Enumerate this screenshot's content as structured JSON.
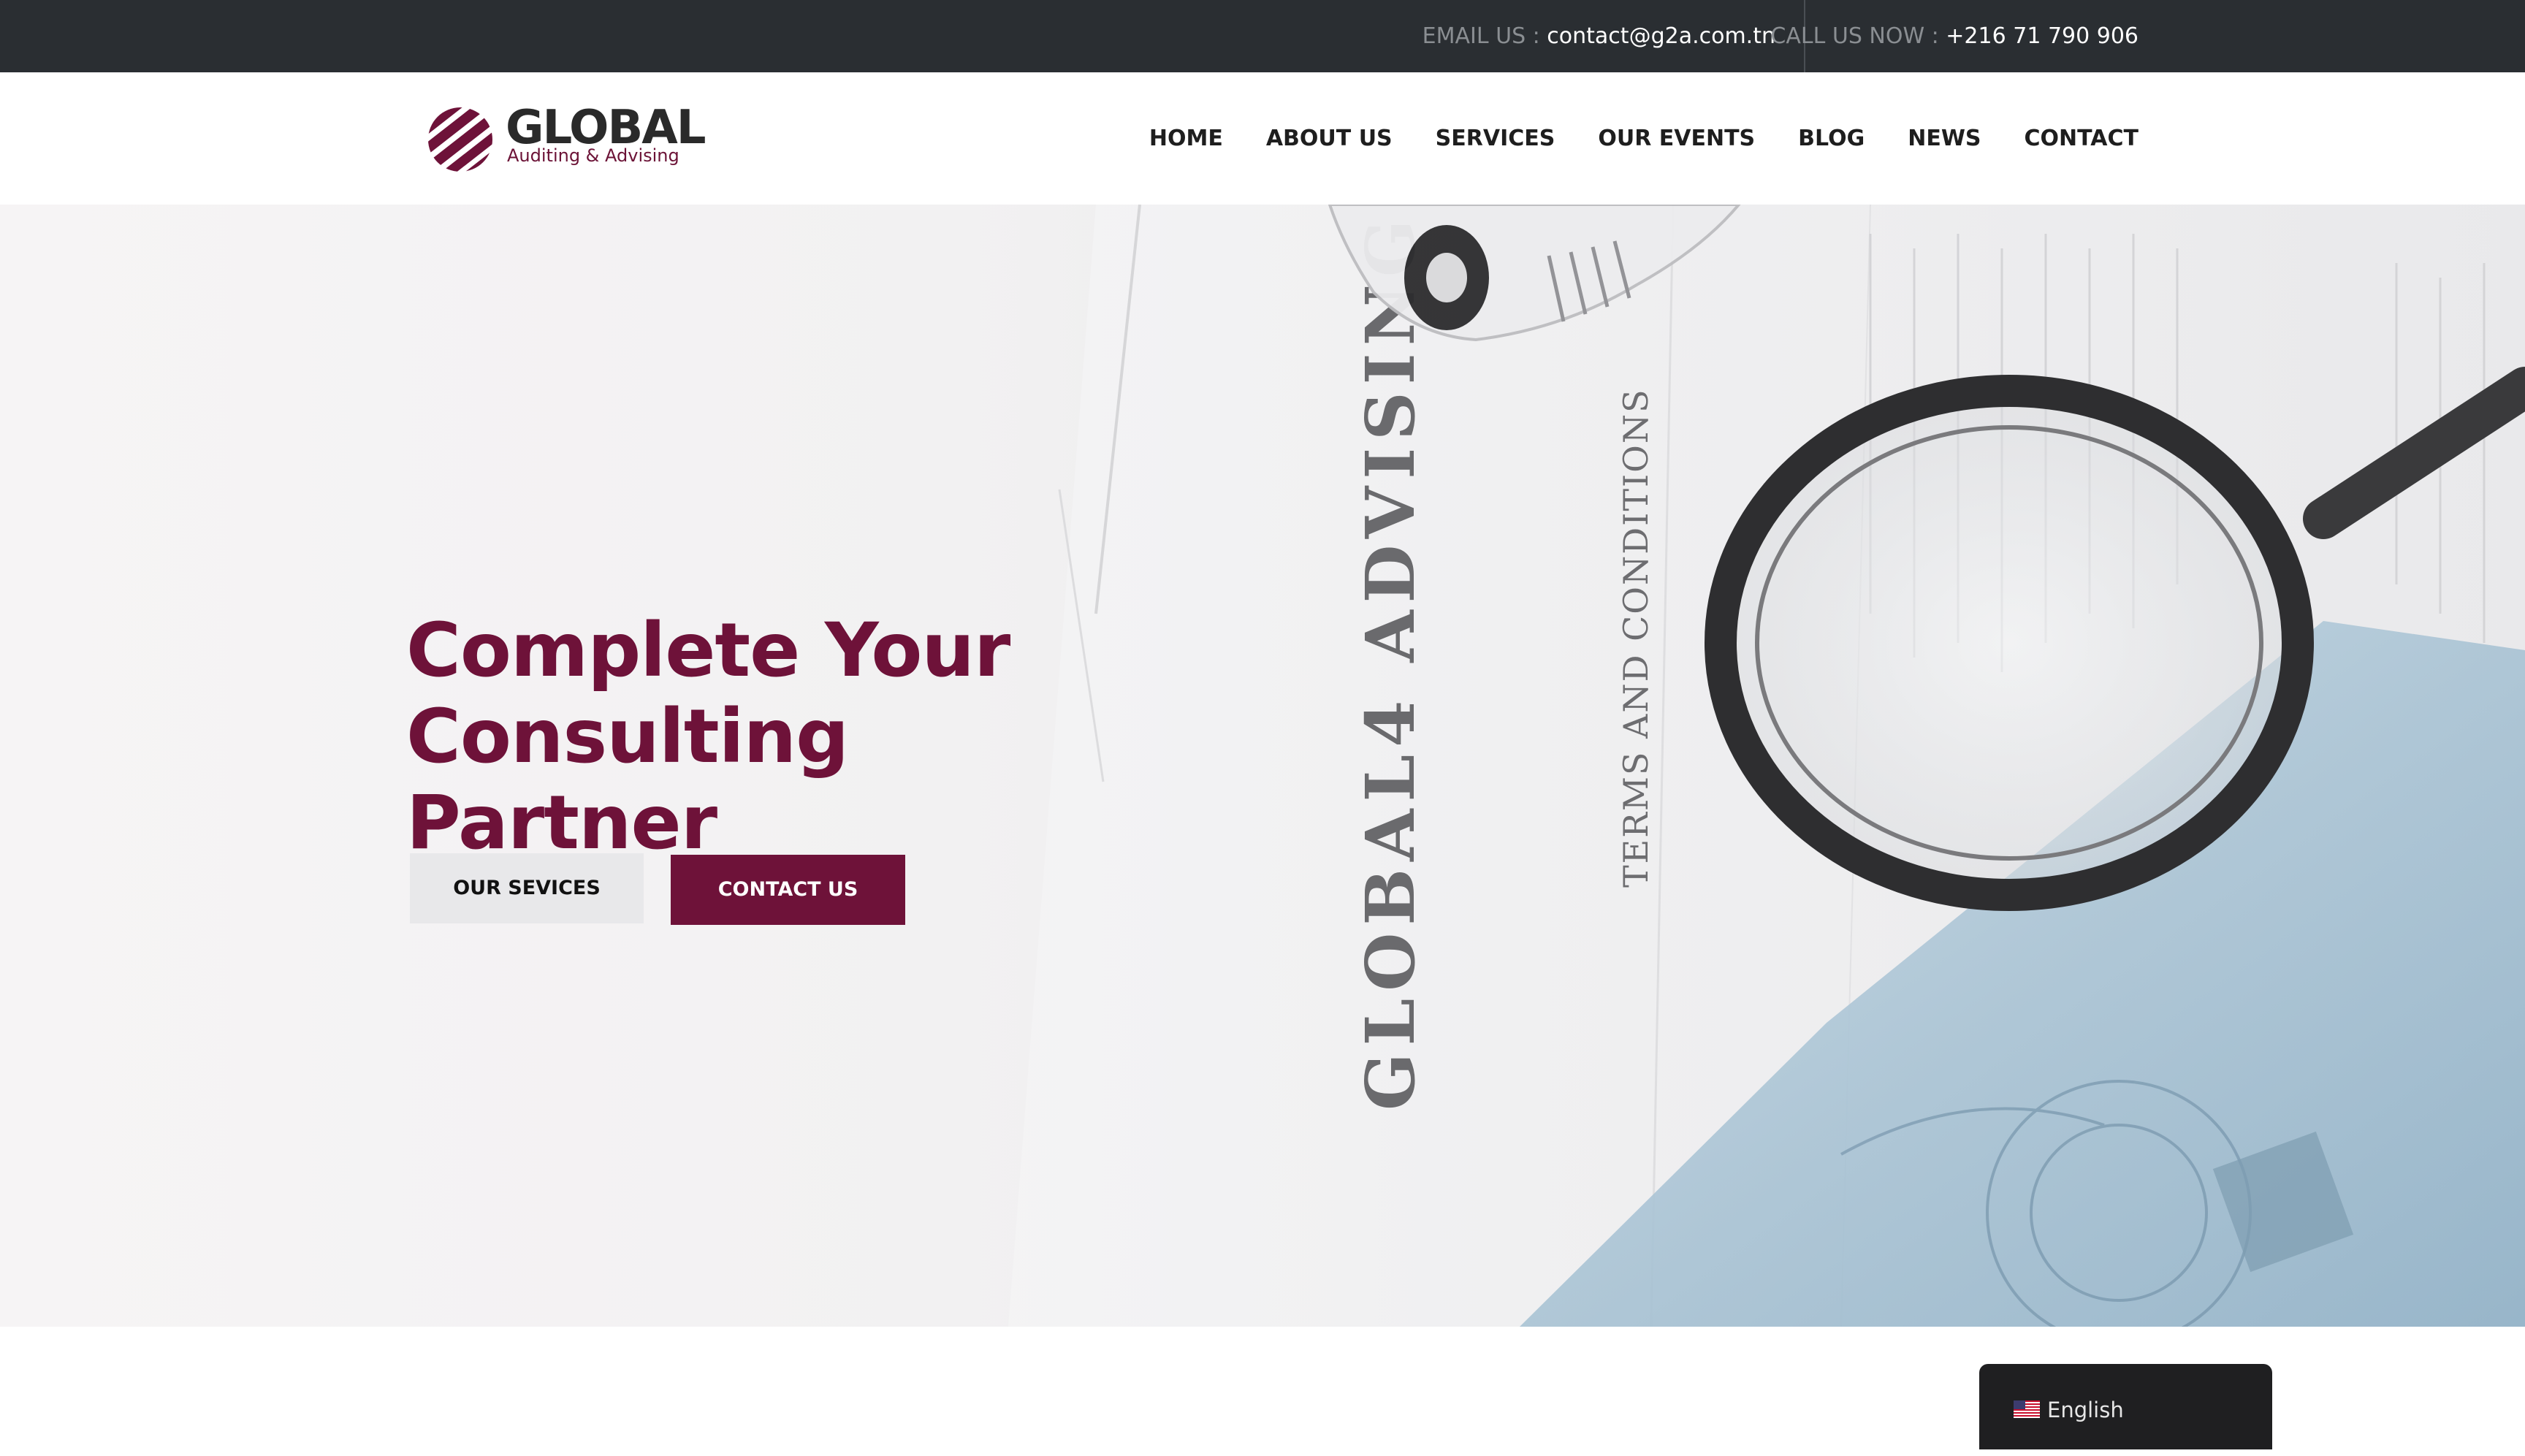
{
  "topbar": {
    "email_label": "EMAIL US : ",
    "email_value": "contact@g2a.com.tn",
    "phone_label": "CALL US NOW : ",
    "phone_value": "+216 71 790 906"
  },
  "logo": {
    "title": "GLOBAL",
    "subtitle": "Auditing & Advising",
    "icon": "striped-sphere-logo-icon",
    "color": "#6e1239"
  },
  "nav": {
    "items": [
      "HOME",
      "ABOUT US",
      "SERVICES",
      "OUR EVENTS",
      "BLOG",
      "NEWS",
      "CONTACT"
    ]
  },
  "hero": {
    "title": "Complete Your Consulting Partner",
    "services_button": "OUR SEVICES",
    "contact_button": "CONTACT US",
    "image_text_1": "GLOBAL4 ADVISING",
    "image_text_2": "TERMS AND CONDITIONS"
  },
  "language": {
    "label": "English",
    "flag_icon": "us-flag-icon"
  },
  "colors": {
    "brand": "#6e1239",
    "topbar": "#2a2e32",
    "lang_bg": "#1f1f21"
  }
}
